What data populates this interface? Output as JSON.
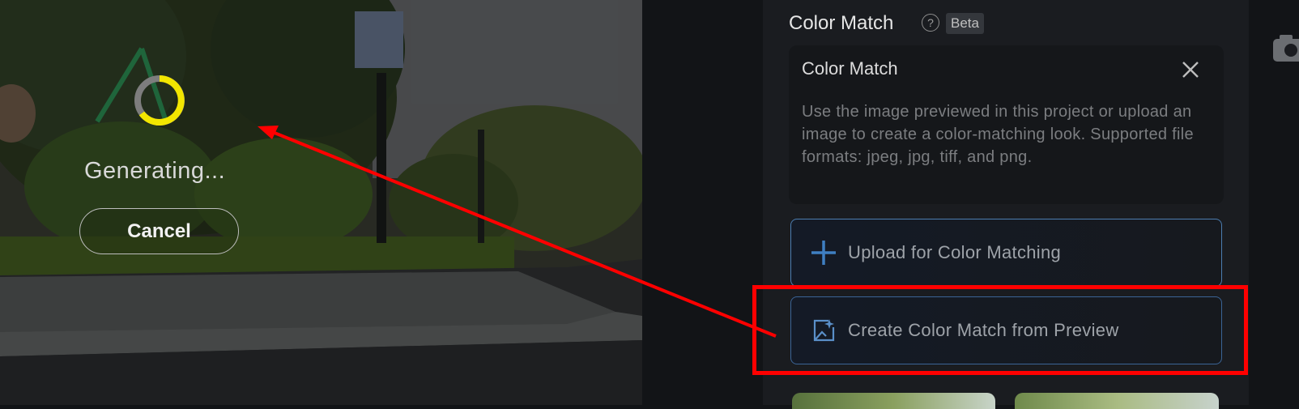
{
  "preview": {
    "status_text": "Generating...",
    "cancel_label": "Cancel",
    "spinner_icon": "loading-spinner-icon",
    "accent": "#f2e600"
  },
  "panel": {
    "title": "Color Match",
    "help_icon": "help-circle-icon",
    "badge": "Beta",
    "info_card": {
      "title": "Color Match",
      "text": "Use the image previewed in this project or upload an image to create a color-matching look. Supported file formats: jpeg, jpg, tiff, and png.",
      "close_icon": "close-icon"
    },
    "upload_button": {
      "label": "Upload for Color Matching",
      "icon": "plus-icon"
    },
    "create_button": {
      "label": "Create Color Match from Preview",
      "icon": "sparkle-image-icon"
    }
  },
  "annotation": {
    "color": "#ff0000"
  }
}
